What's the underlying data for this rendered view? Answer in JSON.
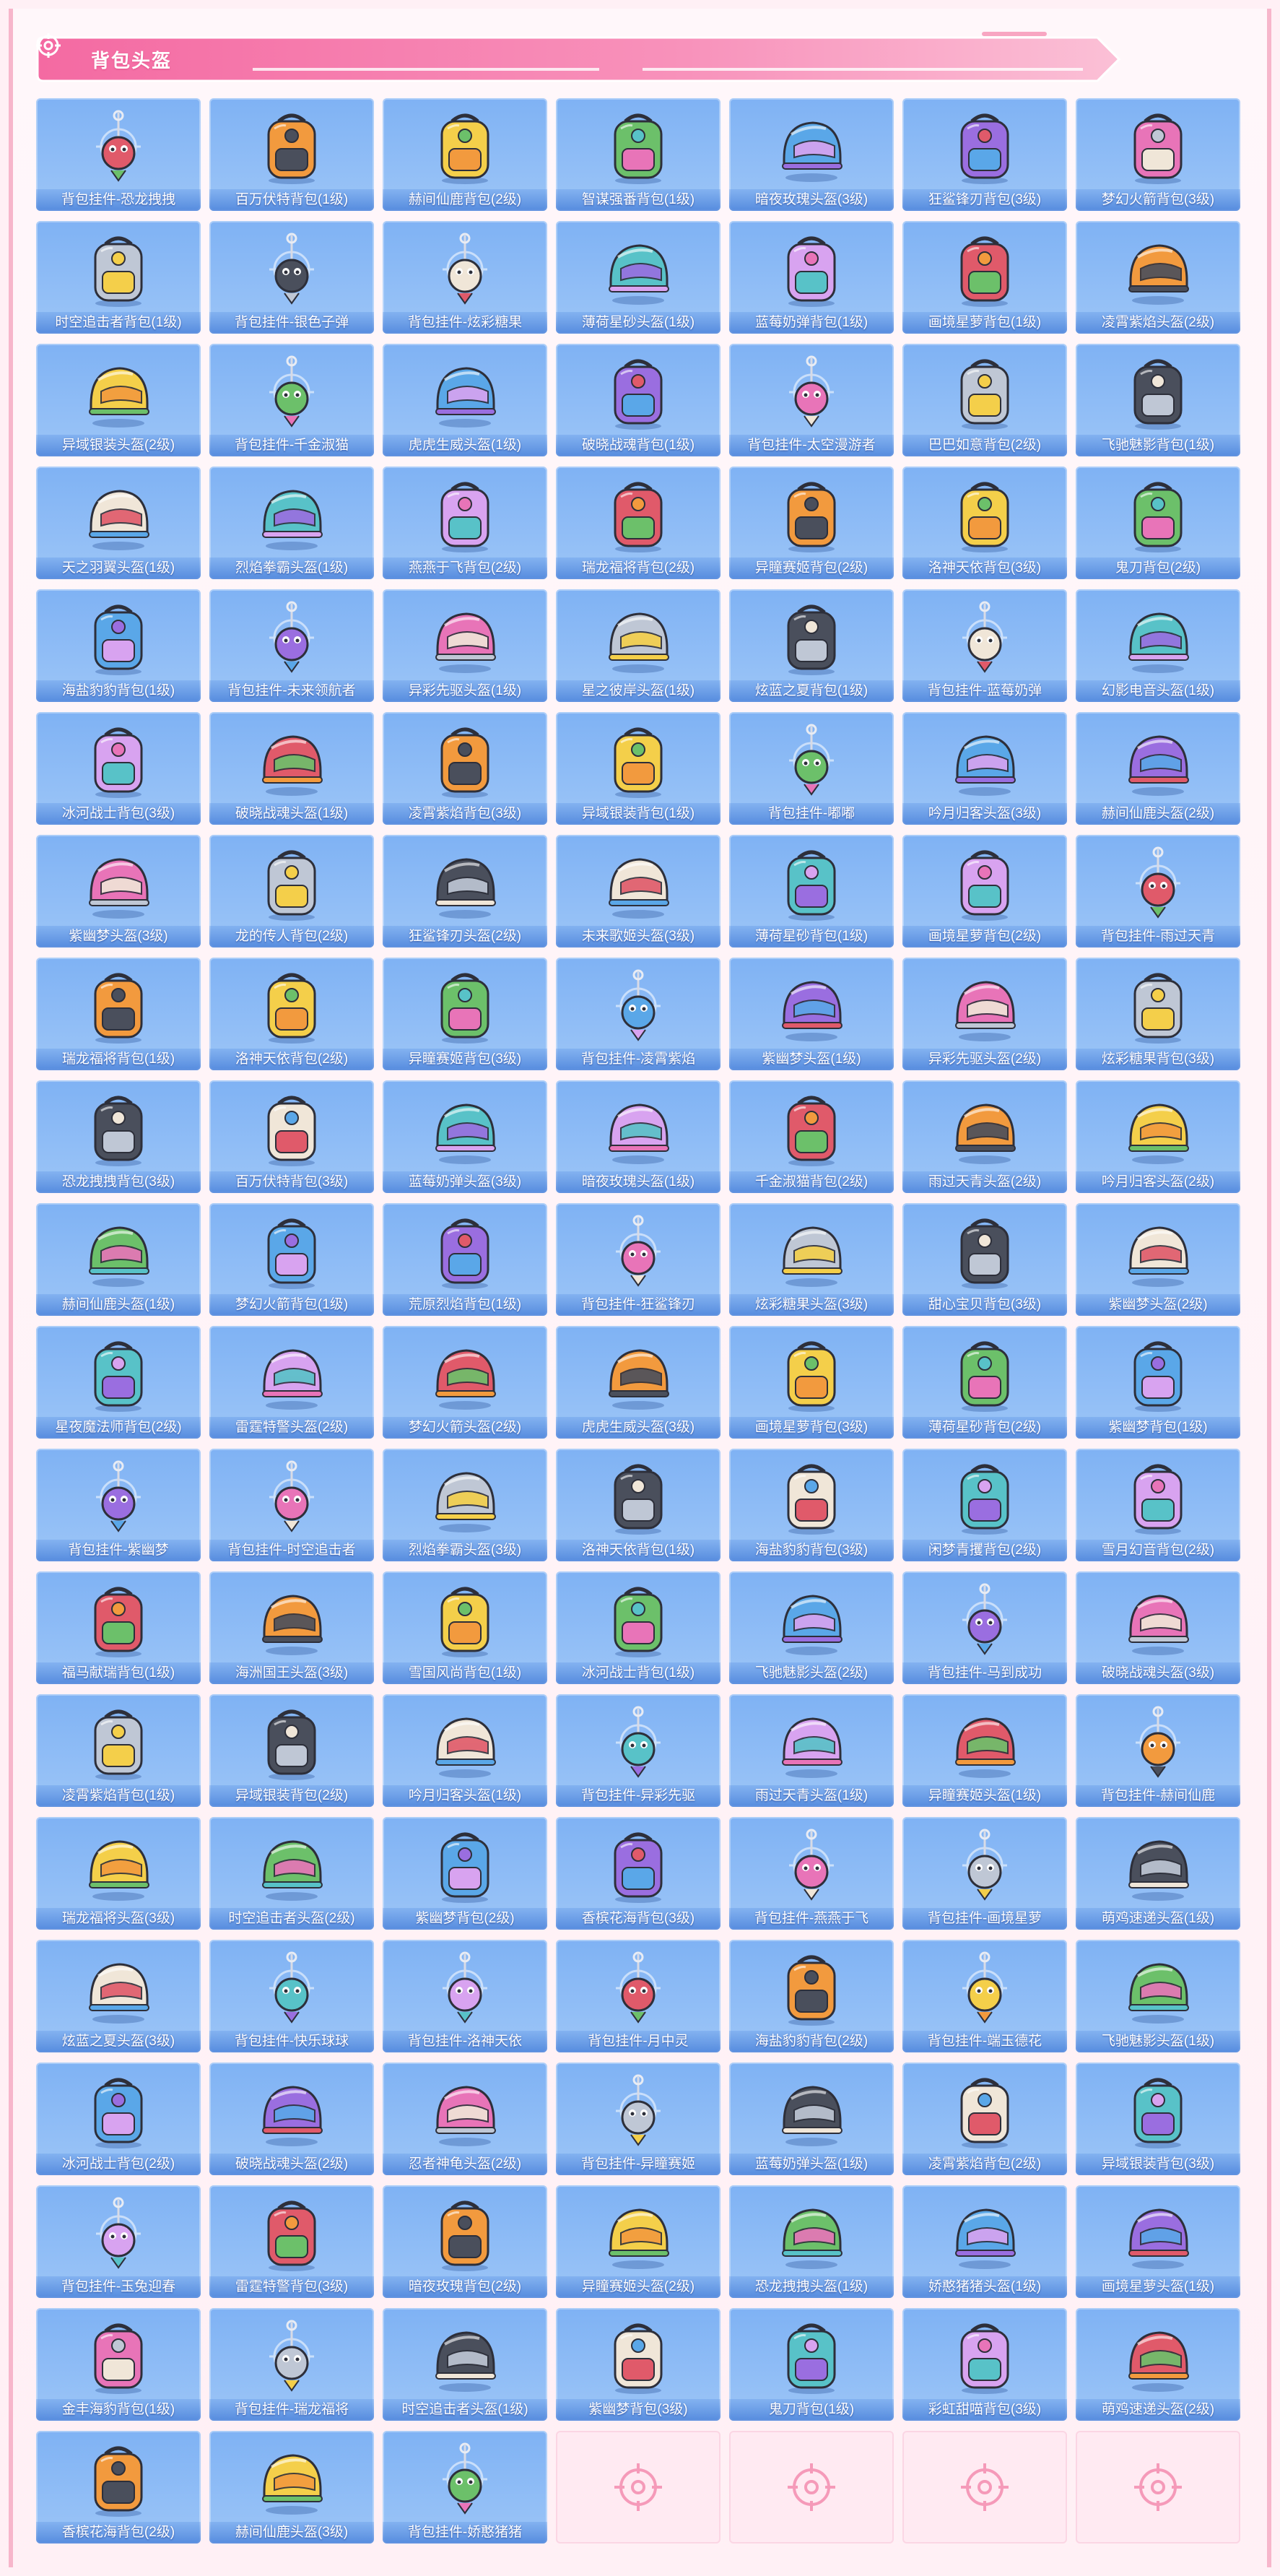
{
  "header": {
    "title": "背包头盔",
    "accent": "#f26aa0"
  },
  "palette": [
    "#e05a6a",
    "#f29a3e",
    "#f4cf4a",
    "#6cc06a",
    "#5aa7e8",
    "#9a6ee0",
    "#e874b8",
    "#bfc7d5",
    "#4a4f5c",
    "#f0e6d8",
    "#58c2c8",
    "#d8a3f0"
  ],
  "items": [
    "背包挂件-恐龙拽拽",
    "百万伏特背包(1级)",
    "赫间仙鹿背包(2级)",
    "智谋强番背包(1级)",
    "暗夜玫瑰头盔(3级)",
    "狂鲨锋刃背包(3级)",
    "梦幻火箭背包(3级)",
    "时空追击者背包(1级)",
    "背包挂件-银色子弹",
    "背包挂件-炫彩糖果",
    "薄荷星砂头盔(1级)",
    "蓝莓奶弹背包(1级)",
    "画境星萝背包(1级)",
    "凌霄紫焰头盔(2级)",
    "异域银装头盔(2级)",
    "背包挂件-千金淑猫",
    "虎虎生威头盔(1级)",
    "破晓战魂背包(1级)",
    "背包挂件-太空漫游者",
    "巴巴如意背包(2级)",
    "飞驰魅影背包(1级)",
    "天之羽翼头盔(1级)",
    "烈焰拳霸头盔(1级)",
    "燕燕于飞背包(2级)",
    "瑞龙福将背包(2级)",
    "异瞳赛姬背包(2级)",
    "洛神天依背包(3级)",
    "鬼刀背包(2级)",
    "海盐豹豹背包(1级)",
    "背包挂件-未来领航者",
    "异彩先驱头盔(1级)",
    "星之彼岸头盔(1级)",
    "炫蓝之夏背包(1级)",
    "背包挂件-蓝莓奶弹",
    "幻影电音头盔(1级)",
    "冰河战士背包(3级)",
    "破晓战魂头盔(1级)",
    "凌霄紫焰背包(3级)",
    "异域银装背包(1级)",
    "背包挂件-嘟嘟",
    "吟月归客头盔(3级)",
    "赫间仙鹿头盔(2级)",
    "紫幽梦头盔(3级)",
    "龙的传人背包(2级)",
    "狂鲨锋刃头盔(2级)",
    "未来歌姬头盔(3级)",
    "薄荷星砂背包(1级)",
    "画境星萝背包(2级)",
    "背包挂件-雨过天青",
    "瑞龙福将背包(1级)",
    "洛神天依背包(2级)",
    "异瞳赛姬背包(3级)",
    "背包挂件-凌霄紫焰",
    "紫幽梦头盔(1级)",
    "异彩先驱头盔(2级)",
    "炫彩糖果背包(3级)",
    "恐龙拽拽背包(3级)",
    "百万伏特背包(3级)",
    "蓝莓奶弹头盔(3级)",
    "暗夜玫瑰头盔(1级)",
    "千金淑猫背包(2级)",
    "雨过天青头盔(2级)",
    "吟月归客头盔(2级)",
    "赫间仙鹿头盔(1级)",
    "梦幻火箭背包(1级)",
    "荒原烈焰背包(1级)",
    "背包挂件-狂鲨锋刃",
    "炫彩糖果头盔(3级)",
    "甜心宝贝背包(3级)",
    "紫幽梦头盔(2级)",
    "星夜魔法师背包(2级)",
    "雷霆特警头盔(2级)",
    "梦幻火箭头盔(2级)",
    "虎虎生威头盔(3级)",
    "画境星萝背包(3级)",
    "薄荷星砂背包(2级)",
    "紫幽梦背包(1级)",
    "背包挂件-紫幽梦",
    "背包挂件-时空追击者",
    "烈焰拳霸头盔(3级)",
    "洛神天依背包(1级)",
    "海盐豹豹背包(3级)",
    "闲梦青攫背包(2级)",
    "雪月幻音背包(2级)",
    "福马献瑞背包(1级)",
    "海洲国王头盔(3级)",
    "雪国风尚背包(1级)",
    "冰河战士背包(1级)",
    "飞驰魅影头盔(2级)",
    "背包挂件-马到成功",
    "破晓战魂头盔(3级)",
    "凌霄紫焰背包(1级)",
    "异域银装背包(2级)",
    "吟月归客头盔(1级)",
    "背包挂件-异彩先驱",
    "雨过天青头盔(1级)",
    "异瞳赛姬头盔(1级)",
    "背包挂件-赫间仙鹿",
    "瑞龙福将头盔(3级)",
    "时空追击者头盔(2级)",
    "紫幽梦背包(2级)",
    "香槟花海背包(3级)",
    "背包挂件-燕燕于飞",
    "背包挂件-画境星萝",
    "萌鸡速递头盔(1级)",
    "炫蓝之夏头盔(3级)",
    "背包挂件-快乐球球",
    "背包挂件-洛神天依",
    "背包挂件-月中灵",
    "海盐豹豹背包(2级)",
    "背包挂件-端玉德花",
    "飞驰魅影头盔(1级)",
    "冰河战士背包(2级)",
    "破晓战魂头盔(2级)",
    "忍者神龟头盔(2级)",
    "背包挂件-异瞳赛姬",
    "蓝莓奶弹头盔(1级)",
    "凌霄紫焰背包(2级)",
    "异域银装背包(3级)",
    "背包挂件-玉兔迎春",
    "雷霆特警背包(3级)",
    "暗夜玫瑰背包(2级)",
    "异瞳赛姬头盔(2级)",
    "恐龙拽拽头盔(1级)",
    "娇憨猪猪头盔(1级)",
    "画境星萝头盔(1级)",
    "金丰海豹背包(1级)",
    "背包挂件-瑞龙福将",
    "时空追击者头盔(1级)",
    "紫幽梦背包(3级)",
    "鬼刀背包(1级)",
    "彩虹甜喵背包(3级)",
    "萌鸡速递头盔(2级)",
    "香槟花海背包(2级)",
    "赫间仙鹿头盔(3级)",
    "背包挂件-娇憨猪猪"
  ],
  "empty_slots": 4
}
